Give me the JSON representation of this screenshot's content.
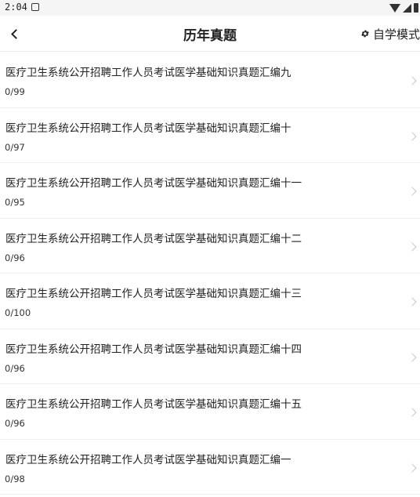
{
  "status_bar": {
    "time": "2:04",
    "icons": [
      "app-notification-icon",
      "wifi-icon",
      "signal-icon",
      "battery-icon"
    ]
  },
  "header": {
    "title": "历年真题",
    "back_icon": "chevron-left-icon",
    "mode_label": "自学模式",
    "mode_icon": "gear-icon"
  },
  "items": [
    {
      "title": "医疗卫生系统公开招聘工作人员考试医学基础知识真题汇编九",
      "progress": "0/99"
    },
    {
      "title": "医疗卫生系统公开招聘工作人员考试医学基础知识真题汇编十",
      "progress": "0/97"
    },
    {
      "title": "医疗卫生系统公开招聘工作人员考试医学基础知识真题汇编十一",
      "progress": "0/95"
    },
    {
      "title": "医疗卫生系统公开招聘工作人员考试医学基础知识真题汇编十二",
      "progress": "0/96"
    },
    {
      "title": "医疗卫生系统公开招聘工作人员考试医学基础知识真题汇编十三",
      "progress": "0/100"
    },
    {
      "title": "医疗卫生系统公开招聘工作人员考试医学基础知识真题汇编十四",
      "progress": "0/96"
    },
    {
      "title": "医疗卫生系统公开招聘工作人员考试医学基础知识真题汇编十五",
      "progress": "0/96"
    },
    {
      "title": "医疗卫生系统公开招聘工作人员考试医学基础知识真题汇编一",
      "progress": "0/98"
    }
  ]
}
